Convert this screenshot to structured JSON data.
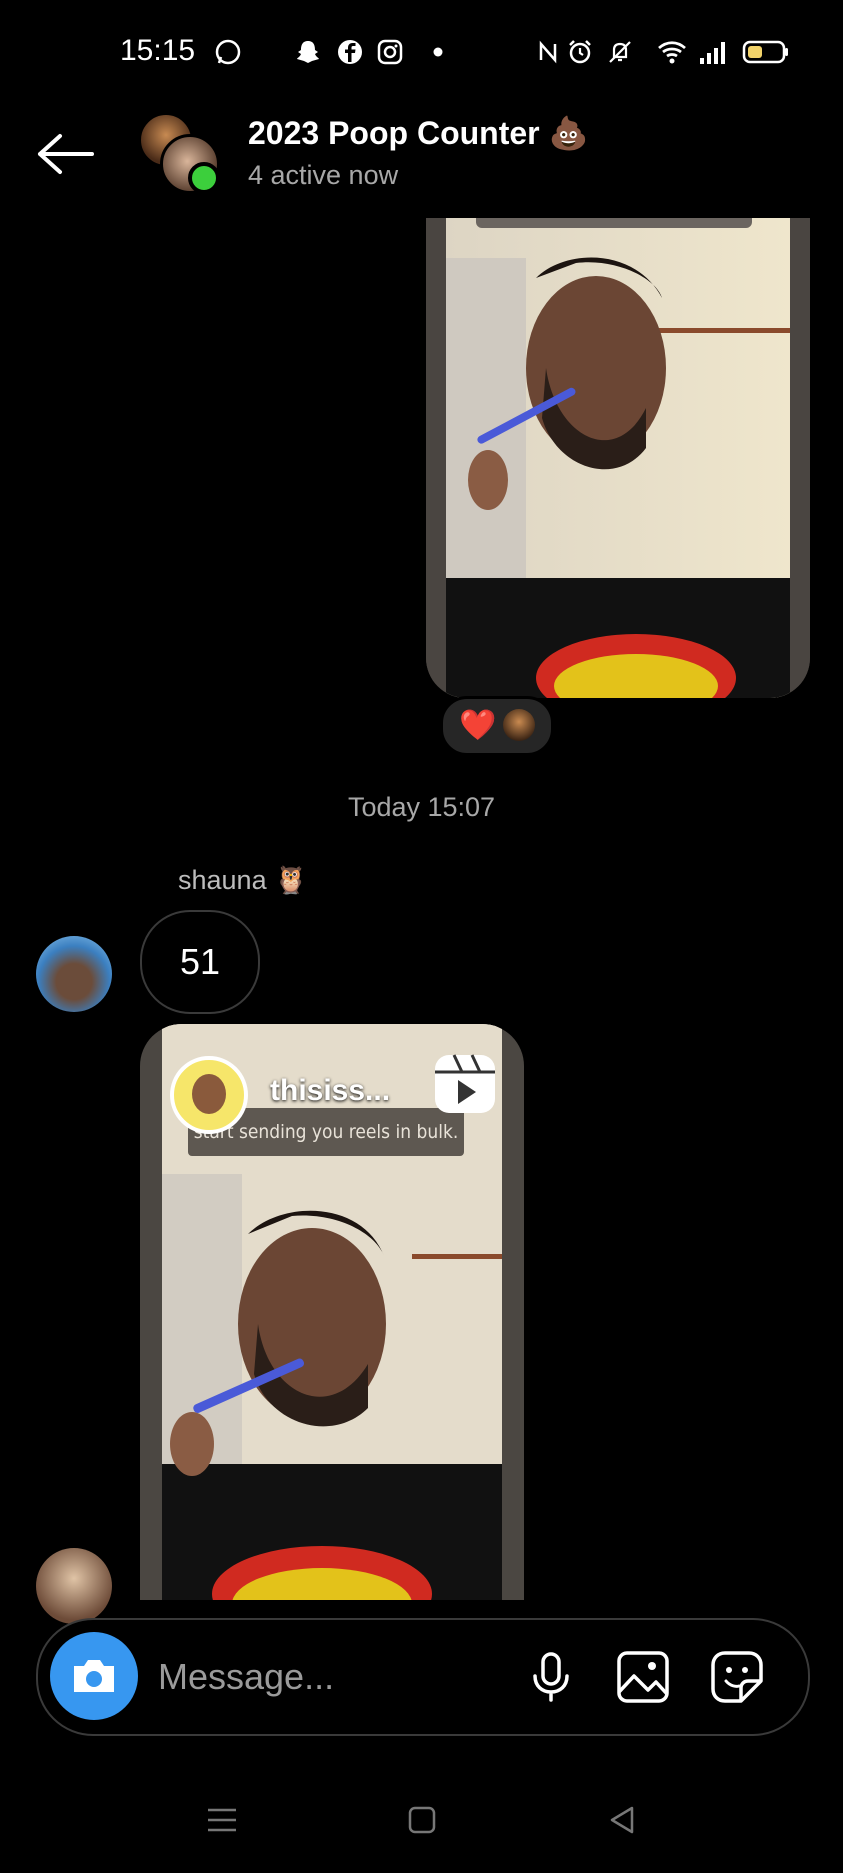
{
  "status_bar": {
    "time": "15:15",
    "icons": [
      "whatsapp-icon",
      "snapchat-icon",
      "facebook-icon",
      "instagram-icon",
      "dot-icon",
      "nfc-icon",
      "alarm-icon",
      "mute-icon",
      "wifi-icon",
      "signal-icon",
      "battery-icon"
    ]
  },
  "header": {
    "title": "2023 Poop Counter 💩",
    "subtitle": "4 active now"
  },
  "messages": {
    "top_reaction": "❤️",
    "timestamp": "Today 15:07",
    "sender_name": "shauna 🦉",
    "bubble_text": "51",
    "reel": {
      "username": "thisiss...",
      "caption": "start sending you reels in bulk."
    }
  },
  "composer": {
    "placeholder": "Message..."
  }
}
